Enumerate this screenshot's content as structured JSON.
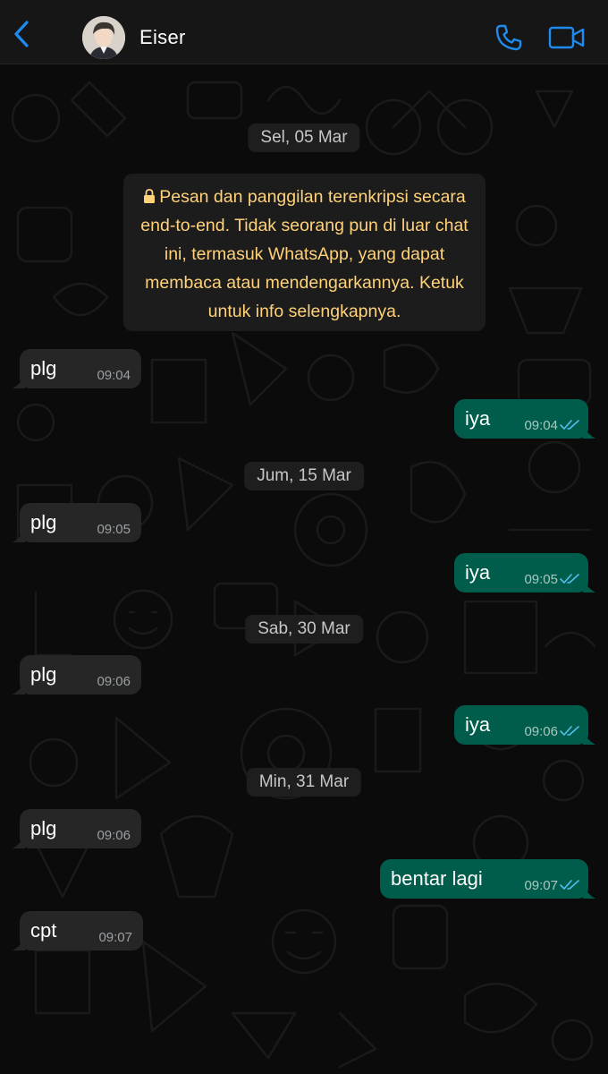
{
  "header": {
    "contact_name": "Eiser",
    "back_icon": "chevron-left-icon",
    "call_icon": "phone-icon",
    "video_icon": "video-camera-icon",
    "accent_color": "#1d8bf0"
  },
  "chat": {
    "dates": [
      "Sel, 05 Mar",
      "Jum, 15 Mar",
      "Sab, 30 Mar",
      "Min, 31 Mar"
    ],
    "encryption_notice": "Pesan dan panggilan terenkripsi secara end-to-end. Tidak seorang pun di luar chat ini, termasuk WhatsApp, yang dapat membaca atau mendengarkannya. Ketuk untuk info selengkapnya.",
    "messages": [
      {
        "direction": "in",
        "text": "plg",
        "time": "09:04"
      },
      {
        "direction": "out",
        "text": "iya",
        "time": "09:04",
        "status": "read"
      },
      {
        "direction": "in",
        "text": "plg",
        "time": "09:05"
      },
      {
        "direction": "out",
        "text": "iya",
        "time": "09:05",
        "status": "read"
      },
      {
        "direction": "in",
        "text": "plg",
        "time": "09:06"
      },
      {
        "direction": "out",
        "text": "iya",
        "time": "09:06",
        "status": "read"
      },
      {
        "direction": "in",
        "text": "plg",
        "time": "09:06"
      },
      {
        "direction": "out",
        "text": "bentar lagi",
        "time": "09:07",
        "status": "read"
      },
      {
        "direction": "in",
        "text": "cpt",
        "time": "09:07"
      }
    ],
    "colors": {
      "incoming_bubble": "#262626",
      "outgoing_bubble": "#005c4b",
      "read_ticks": "#53bdeb",
      "encryption_text": "#ffd279"
    }
  }
}
